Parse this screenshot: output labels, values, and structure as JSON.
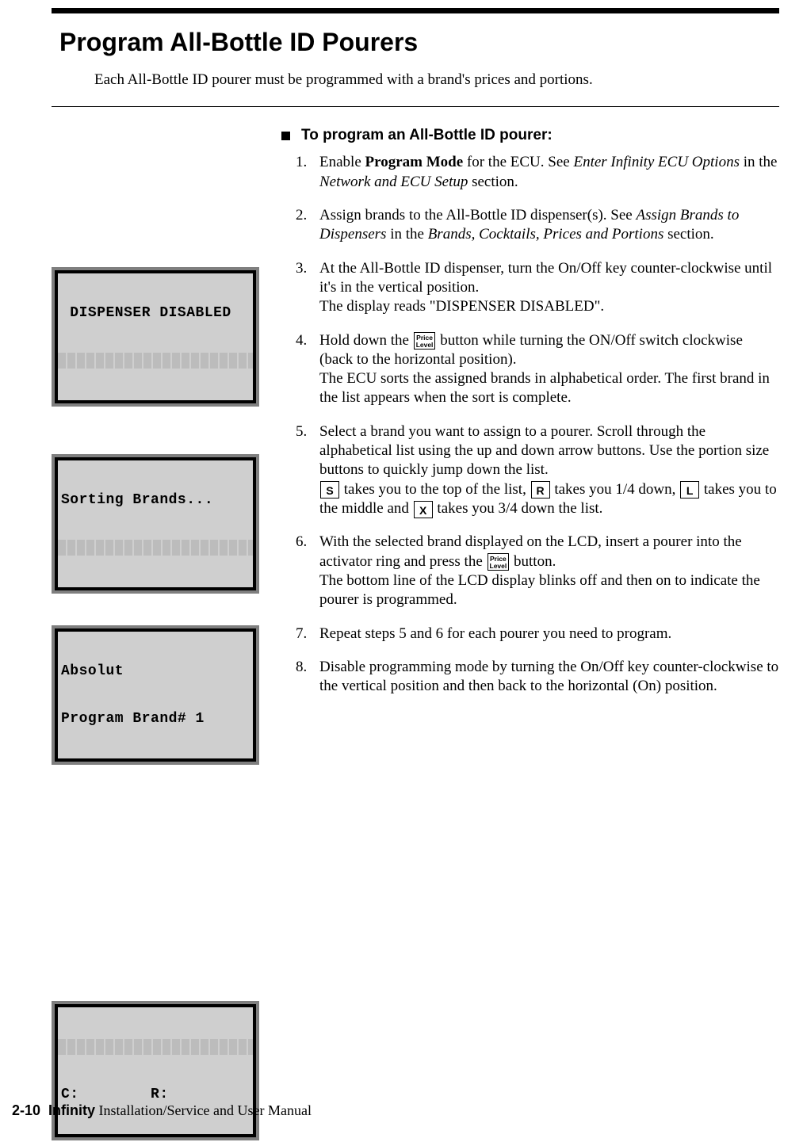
{
  "page_title": "Program All-Bottle ID Pourers",
  "intro": "Each All-Bottle ID pourer must be programmed with a brand's prices and portions.",
  "task_title": "To program an All-Bottle ID pourer:",
  "buttons": {
    "price_level_top": "Price",
    "price_level_bottom": "Level",
    "s": "S",
    "r": "R",
    "l": "L",
    "x": "X"
  },
  "lcds": {
    "disabled_line1": " DISPENSER DISABLED",
    "sorting_line1": "Sorting Brands...",
    "brand_line1": "Absolut",
    "brand_line2": "Program Brand# 1",
    "cr_line2": "C:        R:"
  },
  "steps": {
    "s1a": "Enable ",
    "s1b": "Program Mode",
    "s1c": " for the ECU. See ",
    "s1d": "Enter Infinity ECU Options",
    "s1e": " in the ",
    "s1f": "Network and ECU Setup",
    "s1g": " section.",
    "s2a": "Assign brands to the All-Bottle ID dispenser(s). See ",
    "s2b": "Assign Brands to Dispensers",
    "s2c": " in the ",
    "s2d": "Brands, Cocktails, Prices and Portions",
    "s2e": " section.",
    "s3a": "At the All-Bottle ID dispenser, turn the On/Off key counter-clockwise until it's in the vertical position.",
    "s3b": "The display reads \"DISPENSER DISABLED\".",
    "s4a": "Hold down the ",
    "s4b": " button while turning the ON/Off switch clockwise (back to the horizontal position).",
    "s4c": "The ECU sorts the assigned brands in alphabetical order. The first brand in the list appears when the sort is complete.",
    "s5a": "Select a brand you want to assign to a pourer. Scroll through the alphabetical list using the up and down arrow buttons. Use the portion size buttons to quickly jump down the list.",
    "s5b": " takes you to the top of the list, ",
    "s5c": " takes you 1/4 down, ",
    "s5d": " takes you to the middle and ",
    "s5e": " takes you 3/4 down the list.",
    "s6a": "With the selected brand displayed on the LCD, insert a pourer into the activator ring and press the ",
    "s6b": " button.",
    "s6c": "The bottom line of the LCD display blinks off and then on to indicate the pourer is programmed.",
    "s7": "Repeat steps 5 and 6 for each pourer you need to program.",
    "s8": "Disable programming mode by turning the On/Off key counter-clockwise to the vertical position and then back to the horizontal (On) position."
  },
  "footer": {
    "page_num": "2-10",
    "product": "Infinity",
    "rest": " Installation/Service and User Manual"
  }
}
